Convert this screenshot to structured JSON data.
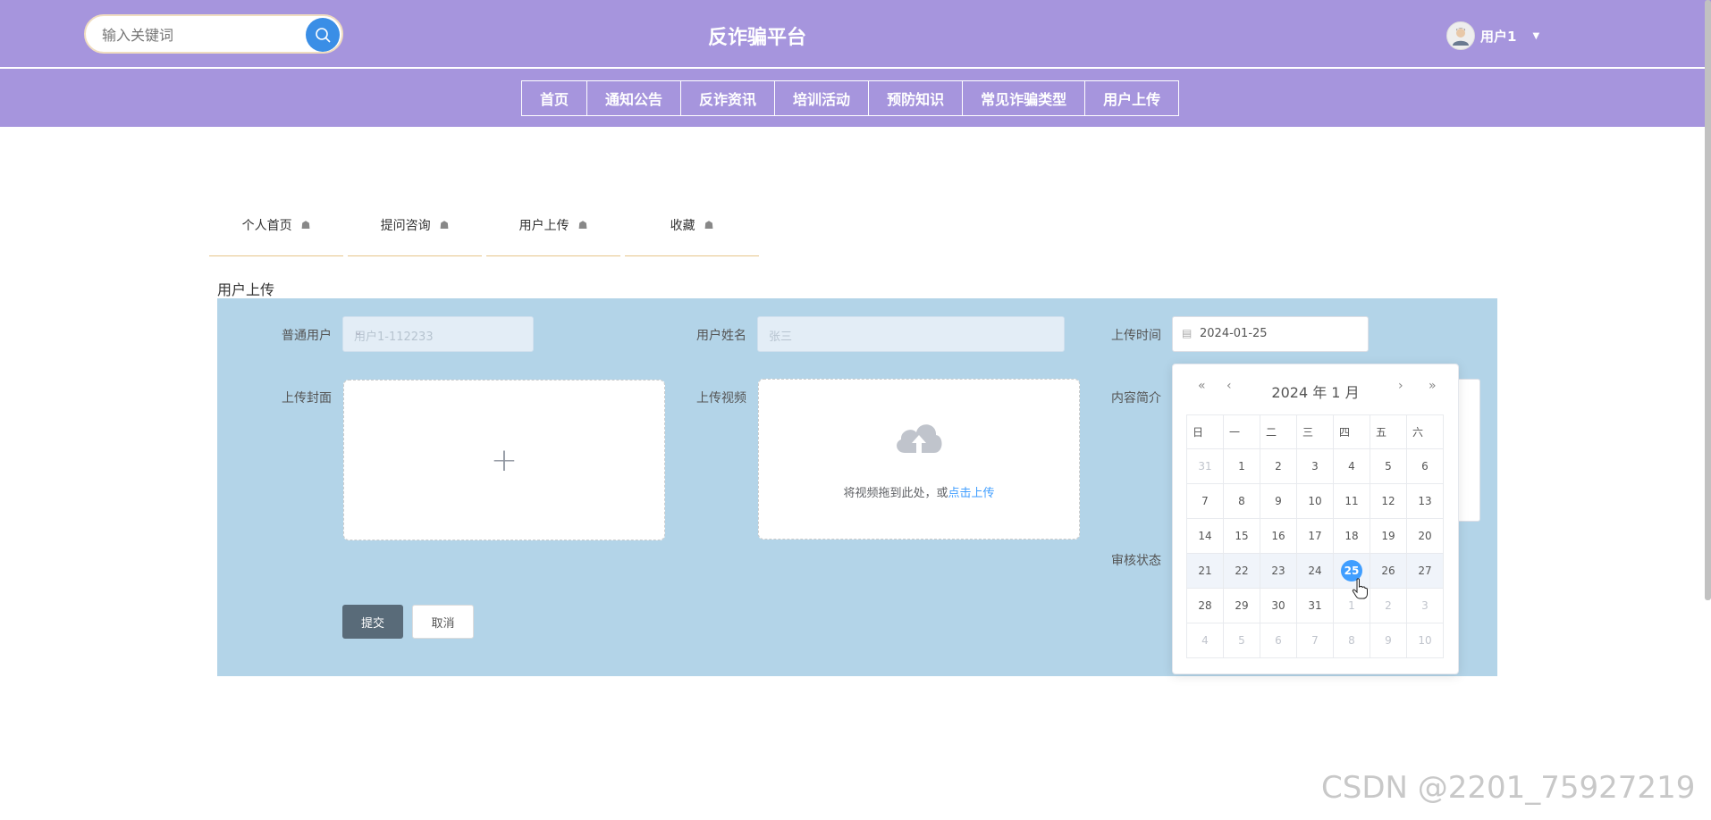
{
  "header": {
    "search_placeholder": "输入关键词",
    "title": "反诈骗平台",
    "user_name": "用户1"
  },
  "nav": [
    "首页",
    "通知公告",
    "反诈资讯",
    "培训活动",
    "预防知识",
    "常见诈骗类型",
    "用户上传"
  ],
  "tabs": [
    "个人首页",
    "提问咨询",
    "用户上传",
    "收藏"
  ],
  "form": {
    "section_title": "用户上传",
    "user_label": "普通用户",
    "user_value": "用户1-112233",
    "name_label": "用户姓名",
    "name_value": "张三",
    "time_label": "上传时间",
    "time_value": "2024-01-25",
    "cover_label": "上传封面",
    "video_label": "上传视频",
    "video_drag_text": "将视频拖到此处，或",
    "video_click_text": "点击上传",
    "intro_label": "内容简介",
    "audit_label": "审核状态",
    "submit_label": "提交",
    "cancel_label": "取消"
  },
  "datepicker": {
    "title": "2024 年  1 月",
    "prev_year": "«",
    "prev_month": "‹",
    "next_month": "›",
    "next_year": "»",
    "weekdays": [
      "日",
      "一",
      "二",
      "三",
      "四",
      "五",
      "六"
    ],
    "weeks": [
      [
        "31",
        "1",
        "2",
        "3",
        "4",
        "5",
        "6"
      ],
      [
        "7",
        "8",
        "9",
        "10",
        "11",
        "12",
        "13"
      ],
      [
        "14",
        "15",
        "16",
        "17",
        "18",
        "19",
        "20"
      ],
      [
        "21",
        "22",
        "23",
        "24",
        "25",
        "26",
        "27"
      ],
      [
        "28",
        "29",
        "30",
        "31",
        "1",
        "2",
        "3"
      ],
      [
        "4",
        "5",
        "6",
        "7",
        "8",
        "9",
        "10"
      ]
    ],
    "selected": "25"
  },
  "watermark": "CSDN @2201_75927219",
  "colors": {
    "header_bg": "#a695dd",
    "form_bg": "#b3d4e8",
    "accent": "#409eff",
    "submit_bg": "#596b79"
  }
}
